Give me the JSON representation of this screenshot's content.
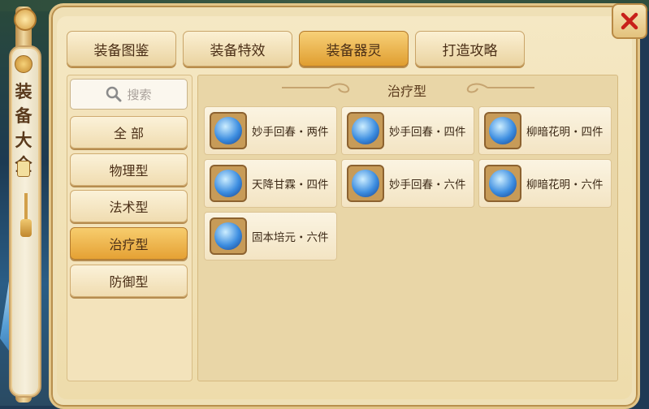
{
  "scroll": {
    "title": "装备大全"
  },
  "tabs": [
    {
      "label": "装备图鉴",
      "active": false
    },
    {
      "label": "装备特效",
      "active": false
    },
    {
      "label": "装备器灵",
      "active": true
    },
    {
      "label": "打造攻略",
      "active": false
    }
  ],
  "search": {
    "placeholder": "搜索"
  },
  "categories": [
    {
      "label": "全 部",
      "active": false
    },
    {
      "label": "物理型",
      "active": false
    },
    {
      "label": "法术型",
      "active": false
    },
    {
      "label": "治疗型",
      "active": true
    },
    {
      "label": "防御型",
      "active": false
    }
  ],
  "section": {
    "title": "治疗型"
  },
  "items": [
    {
      "label": "妙手回春・两件",
      "icon": "wing-orb-icon"
    },
    {
      "label": "妙手回春・四件",
      "icon": "star-orb-icon"
    },
    {
      "label": "柳暗花明・四件",
      "icon": "feather-orb-icon"
    },
    {
      "label": "天降甘霖・四件",
      "icon": "droplet-orb-icon"
    },
    {
      "label": "妙手回春・六件",
      "icon": "wing-orb-icon"
    },
    {
      "label": "柳暗花明・六件",
      "icon": "feather-orb-icon"
    },
    {
      "label": "固本培元・六件",
      "icon": "heart-orb-icon"
    }
  ],
  "colors": {
    "active_tab": "#e09e30",
    "panel": "#efe0b6",
    "close_x": "#c8201a"
  }
}
